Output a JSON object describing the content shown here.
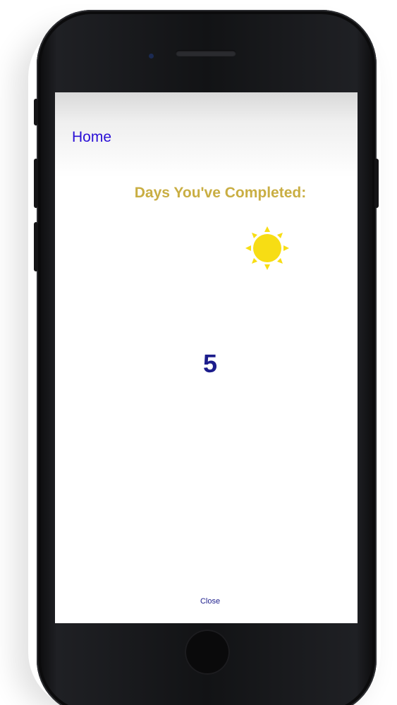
{
  "header": {
    "home_label": "Home"
  },
  "main": {
    "heading": "Days You've Completed:",
    "days_count": "5",
    "sun_icon": "sun-icon"
  },
  "footer": {
    "close_label": "Close"
  },
  "colors": {
    "home_link": "#2a0fd6",
    "heading": "#c9ae43",
    "sun": "#f7dd14",
    "count": "#1c1d8c"
  }
}
